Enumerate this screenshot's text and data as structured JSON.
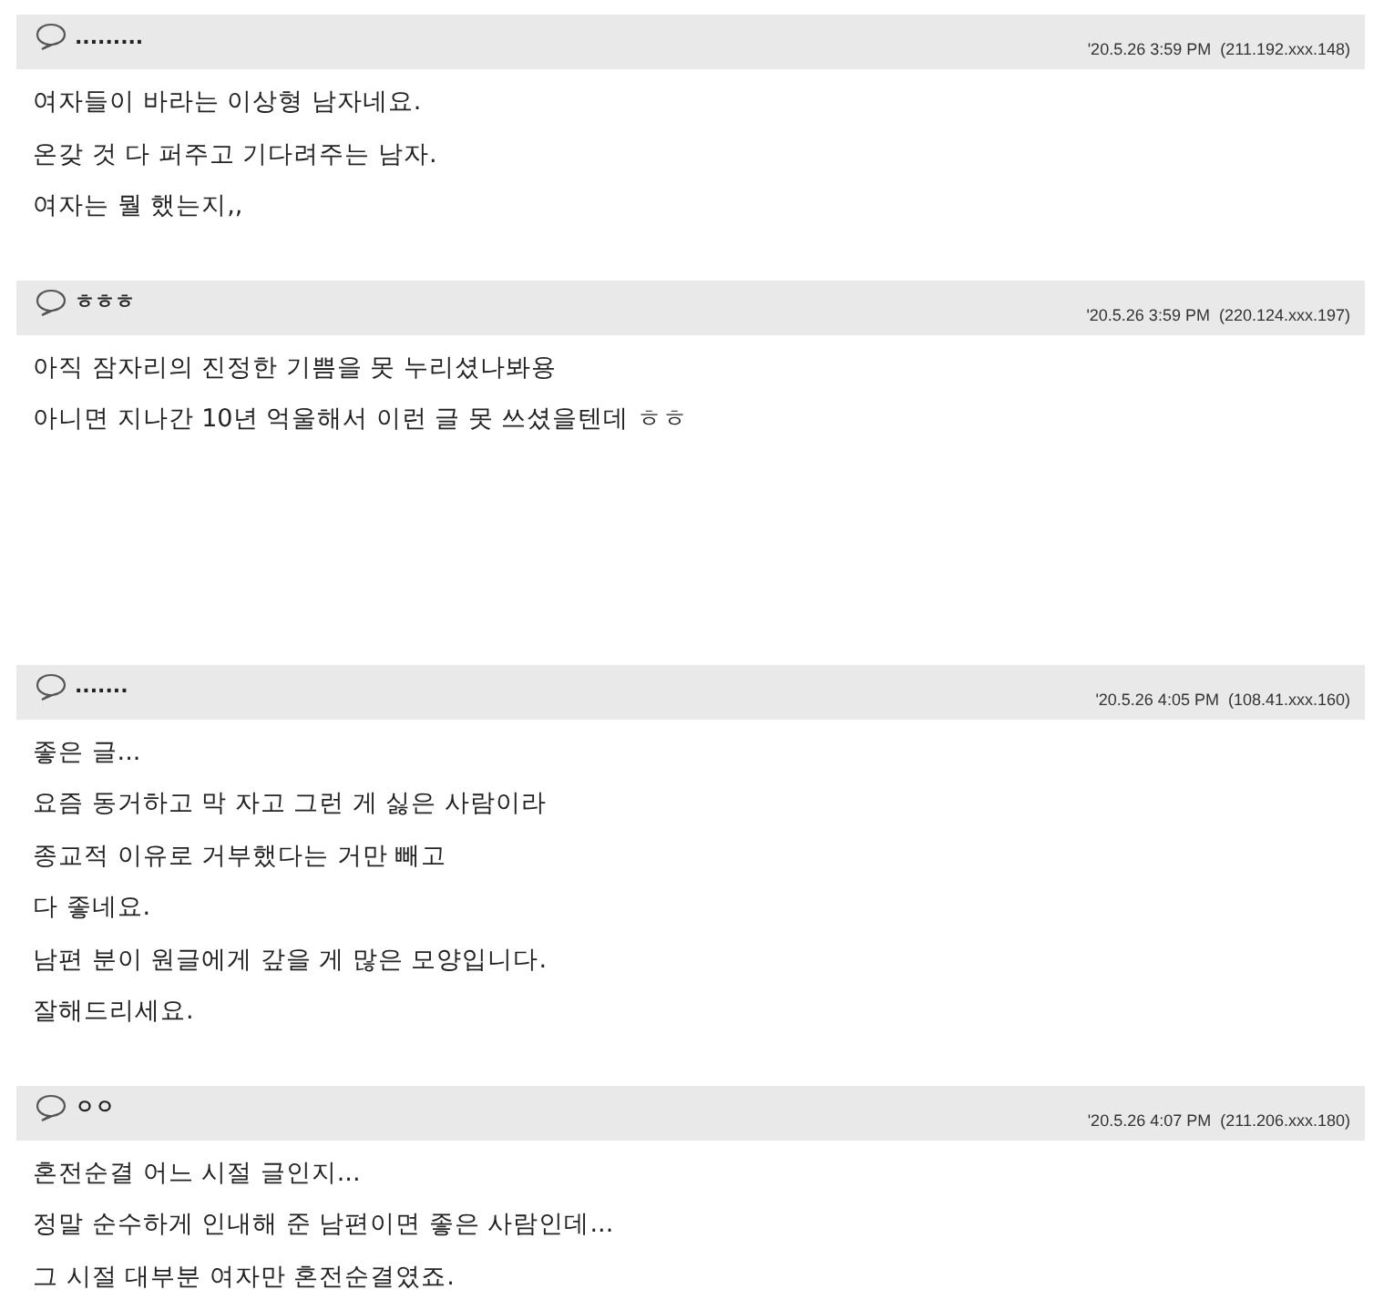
{
  "comments": [
    {
      "author": ".........",
      "time": "'20.5.26 3:59 PM",
      "ip": "(211.192.xxx.148)",
      "lines": [
        "여자들이 바라는 이상형 남자네요.",
        "온갖 것 다 퍼주고 기다려주는 남자.",
        "여자는 뭘 했는지,,"
      ]
    },
    {
      "author": "ㅎㅎㅎ",
      "time": "'20.5.26 3:59 PM",
      "ip": "(220.124.xxx.197)",
      "lines": [
        "아직 잠자리의 진정한 기쁨을 못 누리셨나봐용",
        "아니면 지나간 10년 억울해서 이런 글 못 쓰셨을텐데 ㅎㅎ"
      ]
    },
    {
      "author": ".......",
      "time": "'20.5.26 4:05 PM",
      "ip": "(108.41.xxx.160)",
      "lines": [
        "좋은 글...",
        "요즘 동거하고 막 자고 그런 게 싫은 사람이라",
        "종교적 이유로 거부했다는 거만 빼고",
        "다 좋네요.",
        "남편 분이 원글에게 갚을 게 많은 모양입니다.",
        "잘해드리세요."
      ]
    },
    {
      "author": "ㅇㅇ",
      "time": "'20.5.26 4:07 PM",
      "ip": "(211.206.xxx.180)",
      "lines": [
        "혼전순결 어느 시절 글인지...",
        "정말 순수하게 인내해 준 남편이면 좋은 사람인데...",
        "그 시절 대부분 여자만 혼전순결였죠."
      ]
    }
  ]
}
